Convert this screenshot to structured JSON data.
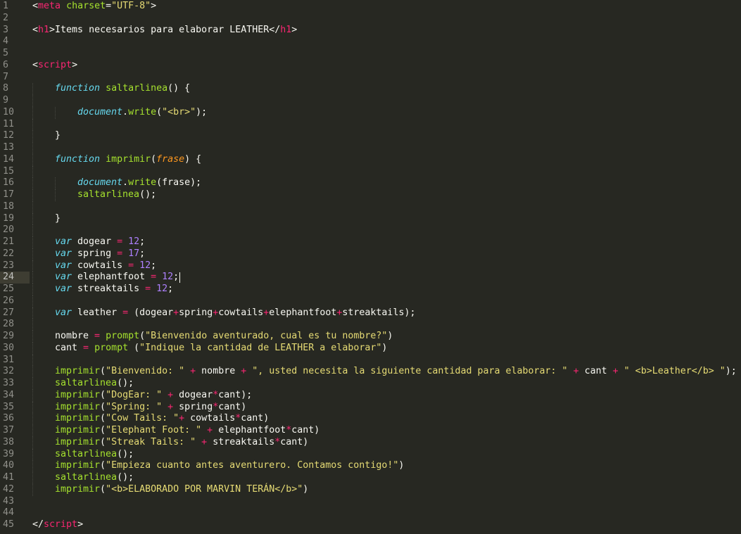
{
  "editor": {
    "active_line": 24,
    "colors": {
      "background": "#272822",
      "line_number": "#90908A",
      "tag": "#F92672",
      "string": "#E6DB74",
      "keyword": "#66D9EF",
      "function": "#A6E22E",
      "number": "#AE81FF",
      "parameter": "#FD971F"
    },
    "lines": [
      {
        "n": "1",
        "indent": 0,
        "tokens": [
          [
            "t-plain",
            "<"
          ],
          [
            "t-tag",
            "meta"
          ],
          [
            "t-plain",
            " "
          ],
          [
            "t-attr",
            "charset"
          ],
          [
            "t-plain",
            "="
          ],
          [
            "t-str",
            "\"UTF-8\""
          ],
          [
            "t-plain",
            ">"
          ]
        ]
      },
      {
        "n": "2",
        "indent": 0,
        "tokens": []
      },
      {
        "n": "3",
        "indent": 0,
        "tokens": [
          [
            "t-plain",
            "<"
          ],
          [
            "t-tag",
            "h1"
          ],
          [
            "t-plain",
            ">Items necesarios para elaborar LEATHER</"
          ],
          [
            "t-tag",
            "h1"
          ],
          [
            "t-plain",
            ">"
          ]
        ]
      },
      {
        "n": "4",
        "indent": 0,
        "tokens": []
      },
      {
        "n": "5",
        "indent": 0,
        "tokens": []
      },
      {
        "n": "6",
        "indent": 0,
        "tokens": [
          [
            "t-plain",
            "<"
          ],
          [
            "t-tag",
            "script"
          ],
          [
            "t-plain",
            ">"
          ]
        ]
      },
      {
        "n": "7",
        "indent": 0,
        "tokens": []
      },
      {
        "n": "8",
        "indent": 1,
        "tokens": [
          [
            "t-kw",
            "function"
          ],
          [
            "t-plain",
            " "
          ],
          [
            "t-fn",
            "saltarlinea"
          ],
          [
            "t-plain",
            "() {"
          ]
        ]
      },
      {
        "n": "9",
        "indent": 1,
        "tokens": []
      },
      {
        "n": "10",
        "indent": 2,
        "tokens": [
          [
            "t-kw",
            "document"
          ],
          [
            "t-plain",
            "."
          ],
          [
            "t-fn",
            "write"
          ],
          [
            "t-plain",
            "("
          ],
          [
            "t-str",
            "\"<br>\""
          ],
          [
            "t-plain",
            ");"
          ]
        ]
      },
      {
        "n": "11",
        "indent": 1,
        "tokens": []
      },
      {
        "n": "12",
        "indent": 1,
        "tokens": [
          [
            "t-plain",
            "}"
          ]
        ]
      },
      {
        "n": "13",
        "indent": 1,
        "tokens": []
      },
      {
        "n": "14",
        "indent": 1,
        "tokens": [
          [
            "t-kw",
            "function"
          ],
          [
            "t-plain",
            " "
          ],
          [
            "t-fn",
            "imprimir"
          ],
          [
            "t-plain",
            "("
          ],
          [
            "t-param",
            "frase"
          ],
          [
            "t-plain",
            ") {"
          ]
        ]
      },
      {
        "n": "15",
        "indent": 1,
        "tokens": []
      },
      {
        "n": "16",
        "indent": 2,
        "tokens": [
          [
            "t-kw",
            "document"
          ],
          [
            "t-plain",
            "."
          ],
          [
            "t-fn",
            "write"
          ],
          [
            "t-plain",
            "(frase);"
          ]
        ]
      },
      {
        "n": "17",
        "indent": 2,
        "tokens": [
          [
            "t-fn",
            "saltarlinea"
          ],
          [
            "t-plain",
            "();"
          ]
        ]
      },
      {
        "n": "18",
        "indent": 1,
        "tokens": []
      },
      {
        "n": "19",
        "indent": 1,
        "tokens": [
          [
            "t-plain",
            "}"
          ]
        ]
      },
      {
        "n": "20",
        "indent": 1,
        "tokens": []
      },
      {
        "n": "21",
        "indent": 1,
        "tokens": [
          [
            "t-kw",
            "var"
          ],
          [
            "t-plain",
            " dogear "
          ],
          [
            "t-op",
            "="
          ],
          [
            "t-plain",
            " "
          ],
          [
            "t-num",
            "12"
          ],
          [
            "t-plain",
            ";"
          ]
        ]
      },
      {
        "n": "22",
        "indent": 1,
        "tokens": [
          [
            "t-kw",
            "var"
          ],
          [
            "t-plain",
            " spring "
          ],
          [
            "t-op",
            "="
          ],
          [
            "t-plain",
            " "
          ],
          [
            "t-num",
            "17"
          ],
          [
            "t-plain",
            ";"
          ]
        ]
      },
      {
        "n": "23",
        "indent": 1,
        "tokens": [
          [
            "t-kw",
            "var"
          ],
          [
            "t-plain",
            " cowtails "
          ],
          [
            "t-op",
            "="
          ],
          [
            "t-plain",
            " "
          ],
          [
            "t-num",
            "12"
          ],
          [
            "t-plain",
            ";"
          ]
        ]
      },
      {
        "n": "24",
        "indent": 1,
        "tokens": [
          [
            "t-kw",
            "var"
          ],
          [
            "t-plain",
            " elephantfoot "
          ],
          [
            "t-op",
            "="
          ],
          [
            "t-plain",
            " "
          ],
          [
            "t-num",
            "12"
          ],
          [
            "t-plain",
            ";"
          ]
        ]
      },
      {
        "n": "25",
        "indent": 1,
        "tokens": [
          [
            "t-kw",
            "var"
          ],
          [
            "t-plain",
            " streaktails "
          ],
          [
            "t-op",
            "="
          ],
          [
            "t-plain",
            " "
          ],
          [
            "t-num",
            "12"
          ],
          [
            "t-plain",
            ";"
          ]
        ]
      },
      {
        "n": "26",
        "indent": 1,
        "tokens": []
      },
      {
        "n": "27",
        "indent": 1,
        "tokens": [
          [
            "t-kw",
            "var"
          ],
          [
            "t-plain",
            " leather "
          ],
          [
            "t-op",
            "="
          ],
          [
            "t-plain",
            " (dogear"
          ],
          [
            "t-op",
            "+"
          ],
          [
            "t-plain",
            "spring"
          ],
          [
            "t-op",
            "+"
          ],
          [
            "t-plain",
            "cowtails"
          ],
          [
            "t-op",
            "+"
          ],
          [
            "t-plain",
            "elephantfoot"
          ],
          [
            "t-op",
            "+"
          ],
          [
            "t-plain",
            "streaktails);"
          ]
        ]
      },
      {
        "n": "28",
        "indent": 1,
        "tokens": []
      },
      {
        "n": "29",
        "indent": 1,
        "tokens": [
          [
            "t-plain",
            "nombre "
          ],
          [
            "t-op",
            "="
          ],
          [
            "t-plain",
            " "
          ],
          [
            "t-fn",
            "prompt"
          ],
          [
            "t-plain",
            "("
          ],
          [
            "t-str",
            "\"Bienvenido aventurado, cual es tu nombre?\""
          ],
          [
            "t-plain",
            ")"
          ]
        ]
      },
      {
        "n": "30",
        "indent": 1,
        "tokens": [
          [
            "t-plain",
            "cant "
          ],
          [
            "t-op",
            "="
          ],
          [
            "t-plain",
            " "
          ],
          [
            "t-fn",
            "prompt"
          ],
          [
            "t-plain",
            " ("
          ],
          [
            "t-str",
            "\"Indique la cantidad de LEATHER a elaborar\""
          ],
          [
            "t-plain",
            ")"
          ]
        ]
      },
      {
        "n": "31",
        "indent": 1,
        "tokens": []
      },
      {
        "n": "32",
        "indent": 1,
        "tokens": [
          [
            "t-fn",
            "imprimir"
          ],
          [
            "t-plain",
            "("
          ],
          [
            "t-str",
            "\"Bienvenido: \""
          ],
          [
            "t-plain",
            " "
          ],
          [
            "t-op",
            "+"
          ],
          [
            "t-plain",
            " nombre "
          ],
          [
            "t-op",
            "+"
          ],
          [
            "t-plain",
            " "
          ],
          [
            "t-str",
            "\", usted necesita la siguiente cantidad para elaborar: \""
          ],
          [
            "t-plain",
            " "
          ],
          [
            "t-op",
            "+"
          ],
          [
            "t-plain",
            " cant "
          ],
          [
            "t-op",
            "+"
          ],
          [
            "t-plain",
            " "
          ],
          [
            "t-str",
            "\" <b>Leather</b> \""
          ],
          [
            "t-plain",
            ");"
          ]
        ]
      },
      {
        "n": "33",
        "indent": 1,
        "tokens": [
          [
            "t-fn",
            "saltarlinea"
          ],
          [
            "t-plain",
            "();"
          ]
        ]
      },
      {
        "n": "34",
        "indent": 1,
        "tokens": [
          [
            "t-fn",
            "imprimir"
          ],
          [
            "t-plain",
            "("
          ],
          [
            "t-str",
            "\"DogEar: \""
          ],
          [
            "t-plain",
            " "
          ],
          [
            "t-op",
            "+"
          ],
          [
            "t-plain",
            " dogear"
          ],
          [
            "t-op",
            "*"
          ],
          [
            "t-plain",
            "cant);"
          ]
        ]
      },
      {
        "n": "35",
        "indent": 1,
        "tokens": [
          [
            "t-fn",
            "imprimir"
          ],
          [
            "t-plain",
            "("
          ],
          [
            "t-str",
            "\"Spring: \""
          ],
          [
            "t-plain",
            " "
          ],
          [
            "t-op",
            "+"
          ],
          [
            "t-plain",
            " spring"
          ],
          [
            "t-op",
            "*"
          ],
          [
            "t-plain",
            "cant)"
          ]
        ]
      },
      {
        "n": "36",
        "indent": 1,
        "tokens": [
          [
            "t-fn",
            "imprimir"
          ],
          [
            "t-plain",
            "("
          ],
          [
            "t-str",
            "\"Cow Tails: \""
          ],
          [
            "t-op",
            "+"
          ],
          [
            "t-plain",
            " cowtails"
          ],
          [
            "t-op",
            "*"
          ],
          [
            "t-plain",
            "cant)"
          ]
        ]
      },
      {
        "n": "37",
        "indent": 1,
        "tokens": [
          [
            "t-fn",
            "imprimir"
          ],
          [
            "t-plain",
            "("
          ],
          [
            "t-str",
            "\"Elephant Foot: \""
          ],
          [
            "t-plain",
            " "
          ],
          [
            "t-op",
            "+"
          ],
          [
            "t-plain",
            " elephantfoot"
          ],
          [
            "t-op",
            "*"
          ],
          [
            "t-plain",
            "cant)"
          ]
        ]
      },
      {
        "n": "38",
        "indent": 1,
        "tokens": [
          [
            "t-fn",
            "imprimir"
          ],
          [
            "t-plain",
            "("
          ],
          [
            "t-str",
            "\"Streak Tails: \""
          ],
          [
            "t-plain",
            " "
          ],
          [
            "t-op",
            "+"
          ],
          [
            "t-plain",
            " streaktails"
          ],
          [
            "t-op",
            "*"
          ],
          [
            "t-plain",
            "cant)"
          ]
        ]
      },
      {
        "n": "39",
        "indent": 1,
        "tokens": [
          [
            "t-fn",
            "saltarlinea"
          ],
          [
            "t-plain",
            "();"
          ]
        ]
      },
      {
        "n": "40",
        "indent": 1,
        "tokens": [
          [
            "t-fn",
            "imprimir"
          ],
          [
            "t-plain",
            "("
          ],
          [
            "t-str",
            "\"Empieza cuanto antes aventurero. Contamos contigo!\""
          ],
          [
            "t-plain",
            ")"
          ]
        ]
      },
      {
        "n": "41",
        "indent": 1,
        "tokens": [
          [
            "t-fn",
            "saltarlinea"
          ],
          [
            "t-plain",
            "();"
          ]
        ]
      },
      {
        "n": "42",
        "indent": 1,
        "tokens": [
          [
            "t-fn",
            "imprimir"
          ],
          [
            "t-plain",
            "("
          ],
          [
            "t-str",
            "\"<b>ELABORADO POR MARVIN TERÁN</b>\""
          ],
          [
            "t-plain",
            ")"
          ]
        ]
      },
      {
        "n": "43",
        "indent": 0,
        "tokens": []
      },
      {
        "n": "44",
        "indent": 0,
        "tokens": []
      },
      {
        "n": "45",
        "indent": 0,
        "tokens": [
          [
            "t-plain",
            "</"
          ],
          [
            "t-tag",
            "script"
          ],
          [
            "t-plain",
            ">"
          ]
        ]
      }
    ]
  }
}
